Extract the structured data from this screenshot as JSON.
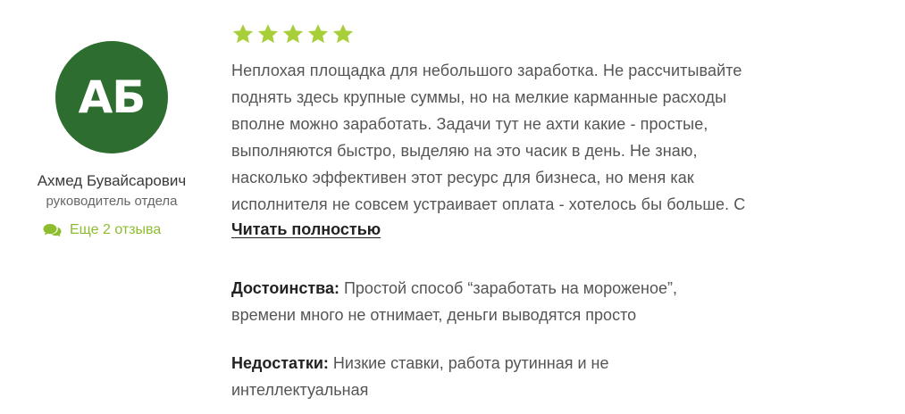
{
  "author": {
    "initials": "АБ",
    "name": "Ахмед Бувайсарович",
    "role": "руководитель отдела",
    "more_reviews_label": "Еще 2 отзыва",
    "avatar_color": "#2e6d30"
  },
  "rating": {
    "stars": 5,
    "max": 5,
    "star_color": "#a8cf3a"
  },
  "review": {
    "text_lines": [
      "Неплохая площадка для небольшого заработка. Не рассчитывайте",
      "поднять здесь крупные суммы, но на мелкие карманные расходы",
      "вполне можно заработать. Задачи тут не ахти какие - простые,",
      "выполняются быстро, выделяю на это часик в день. Не знаю,",
      "насколько эффективен этот ресурс для бизнеса, но меня как",
      "исполнителя не совсем устраивает оплата - хотелось бы больше. С"
    ],
    "read_more_label": "Читать полностью"
  },
  "pros": {
    "label": "Достоинства:",
    "line1": " Простой способ “заработать на мороженое”,",
    "line2": "времени много не отнимает, деньги выводятся просто"
  },
  "cons": {
    "label": "Недостатки:",
    "line1": " Низкие ставки, работа рутинная и не",
    "line2": "интеллектуальная"
  },
  "accent_color": "#8dbd2f"
}
